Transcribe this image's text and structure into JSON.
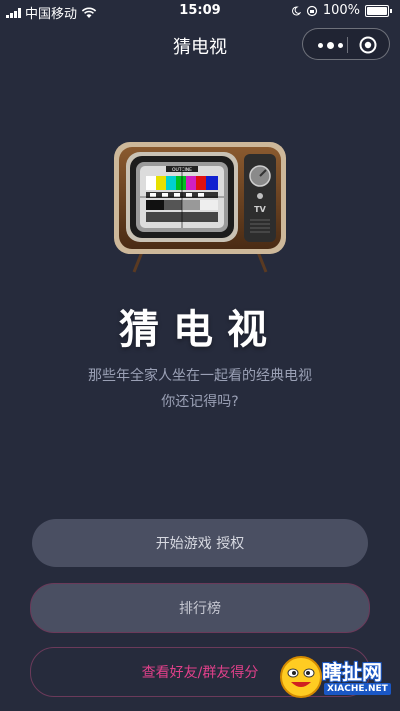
{
  "status_bar": {
    "carrier": "中国移动",
    "time": "15:09",
    "battery": "100%"
  },
  "nav": {
    "title": "猜电视"
  },
  "hero": {
    "tv_brand": "OUTCINE",
    "tv_label": "TV",
    "title": "猜电视",
    "subtitle_line1": "那些年全家人坐在一起看的经典电视",
    "subtitle_line2": "你还记得吗?"
  },
  "buttons": {
    "start": "开始游戏 授权",
    "ranking": "排行榜",
    "friends": "查看好友/群友得分"
  },
  "watermark": {
    "name": "瞎扯网",
    "domain": "XIACHE.NET"
  },
  "colors": {
    "background": "#262b3c",
    "button": "#4a4f62",
    "accent_pink": "#e0408a",
    "border": "#6b3a5a"
  }
}
